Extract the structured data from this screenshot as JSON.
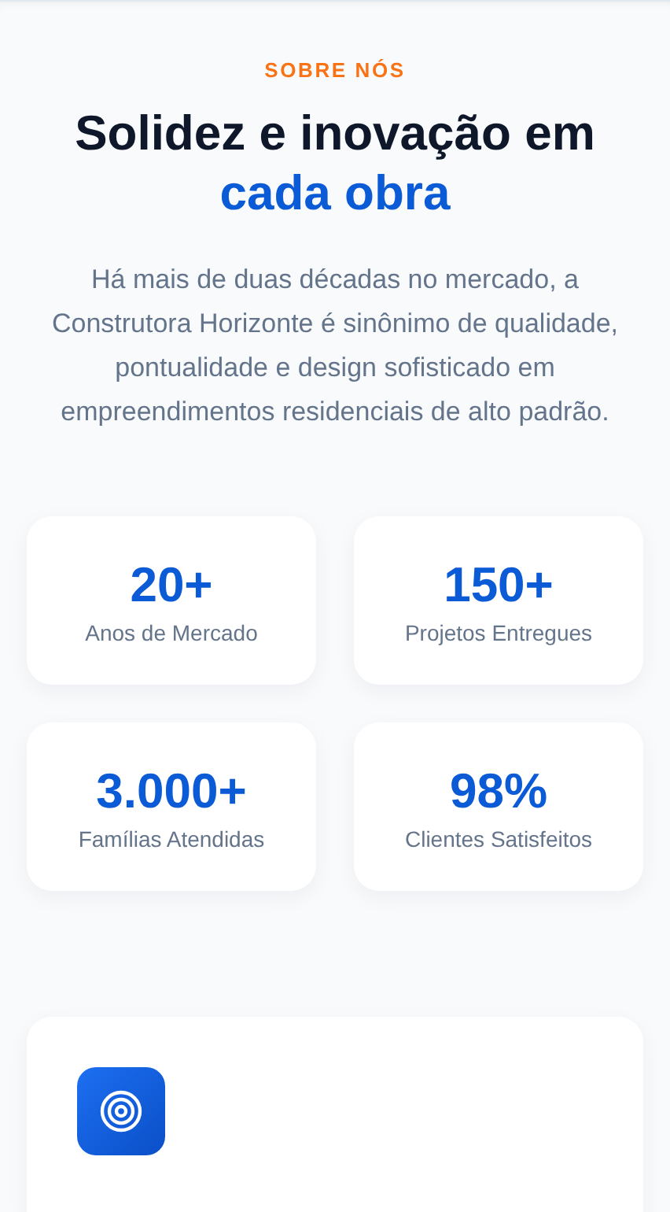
{
  "section_label": "SOBRE NÓS",
  "heading": "Solidez e inovação em",
  "heading_highlight": "cada obra",
  "description": "Há mais de duas décadas no mercado, a Construtora Horizonte é sinônimo de qualidade, pontualidade e design sofisticado em empreendimentos residenciais de alto padrão.",
  "stats": [
    {
      "value": "20+",
      "label": "Anos de Mercado"
    },
    {
      "value": "150+",
      "label": "Projetos Entregues"
    },
    {
      "value": "3.000+",
      "label": "Famílias Atendidas"
    },
    {
      "value": "98%",
      "label": "Clientes Satisfeitos"
    }
  ],
  "feature_card": {
    "kind": "icon-card"
  }
}
